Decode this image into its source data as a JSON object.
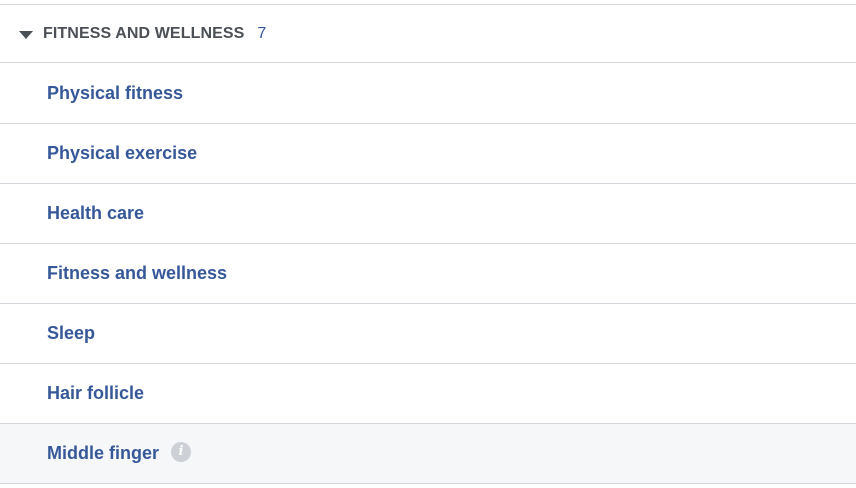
{
  "section": {
    "title": "FITNESS AND WELLNESS",
    "count": "7"
  },
  "items": [
    {
      "label": "Physical fitness"
    },
    {
      "label": "Physical exercise"
    },
    {
      "label": "Health care"
    },
    {
      "label": "Fitness and wellness"
    },
    {
      "label": "Sleep"
    },
    {
      "label": "Hair follicle"
    },
    {
      "label": "Middle finger",
      "info_icon": "info-icon"
    }
  ],
  "colors": {
    "link": "#365899",
    "header_text": "#4b4f56",
    "divider": "#d3d6db",
    "hover_bg": "#f6f7f9",
    "info_icon_bg": "#cdd0d5"
  }
}
